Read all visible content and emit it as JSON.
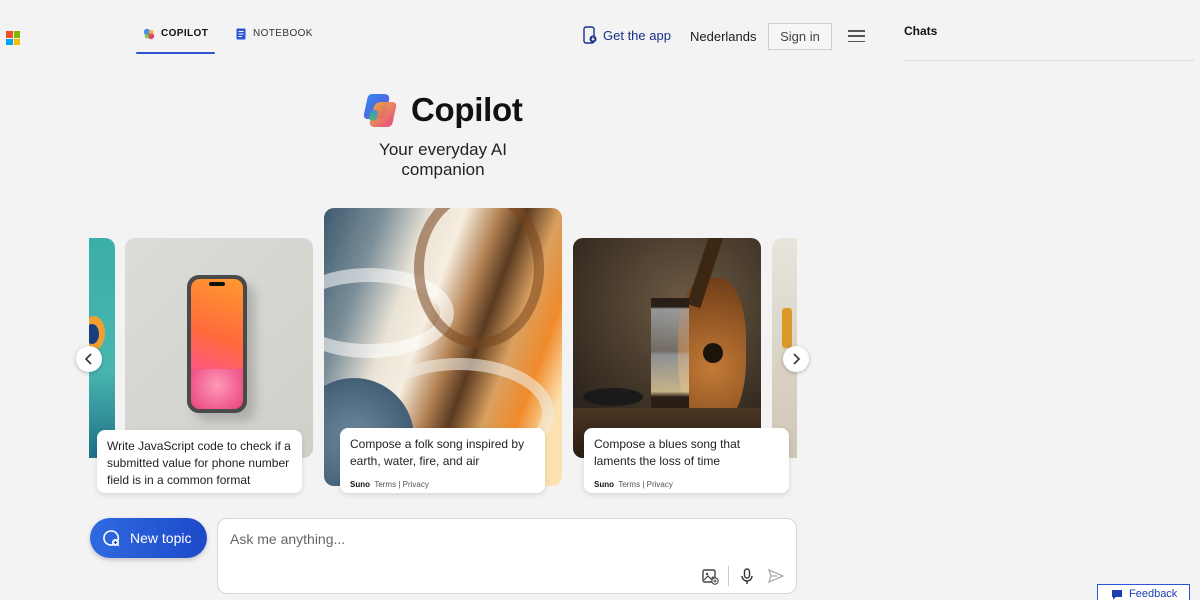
{
  "nav": {
    "tabs": [
      {
        "label": "COPILOT",
        "active": true
      },
      {
        "label": "NOTEBOOK",
        "active": false
      }
    ],
    "get_app": "Get the app",
    "language": "Nederlands",
    "sign_in": "Sign in"
  },
  "chats": {
    "title": "Chats"
  },
  "hero": {
    "title": "Copilot",
    "subtitle": "Your everyday AI companion"
  },
  "carousel": {
    "cards": [
      {
        "text": "Write JavaScript code to check if a submitted value for phone number field is in a common format",
        "brand": "",
        "links": ""
      },
      {
        "text": "Compose a folk song inspired by earth, water, fire, and air",
        "brand": "Suno",
        "links": "Terms | Privacy"
      },
      {
        "text": "Compose a blues song that laments the loss of time",
        "brand": "Suno",
        "links": "Terms | Privacy"
      }
    ]
  },
  "composer": {
    "new_topic": "New topic",
    "placeholder": "Ask me anything..."
  },
  "feedback": "Feedback",
  "colors": {
    "accent": "#2b55d6",
    "background": "#f3f3f3",
    "button_gradient_start": "#2f6ae0",
    "button_gradient_end": "#1d49c9"
  }
}
